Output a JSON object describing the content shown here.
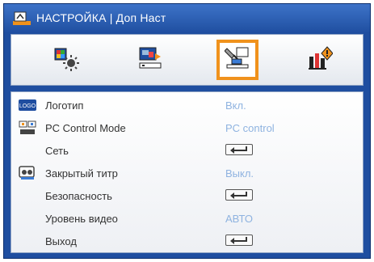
{
  "header": {
    "title": "НАСТРОЙКА | Доп Наст",
    "icon": "settings-tab-icon"
  },
  "tabs": [
    {
      "name": "image-settings",
      "icon": "image-settings-icon",
      "active": false
    },
    {
      "name": "display-settings",
      "icon": "display-settings-icon",
      "active": false
    },
    {
      "name": "setup",
      "icon": "setup-icon",
      "active": true
    },
    {
      "name": "options",
      "icon": "options-icon",
      "active": false
    }
  ],
  "menu": {
    "items": [
      {
        "label": "Логотип",
        "value": "Вкл.",
        "icon": "logo-icon",
        "icon_text": "LOGO"
      },
      {
        "label": "PC Control Mode",
        "value": "PC control",
        "icon": "pc-control-icon"
      },
      {
        "label": "Сеть",
        "control": "enter-key"
      },
      {
        "label": "Закрытый титр",
        "value": "Выкл.",
        "icon": "closed-caption-icon"
      },
      {
        "label": "Безопасность",
        "control": "enter-key"
      },
      {
        "label": "Уровень видео",
        "value": "АВТО"
      },
      {
        "label": "Выход",
        "control": "enter-key"
      }
    ]
  },
  "colors": {
    "frame": "#1f4ea0",
    "active_tab": "#f0921c",
    "value_text": "#8fb3e0"
  }
}
